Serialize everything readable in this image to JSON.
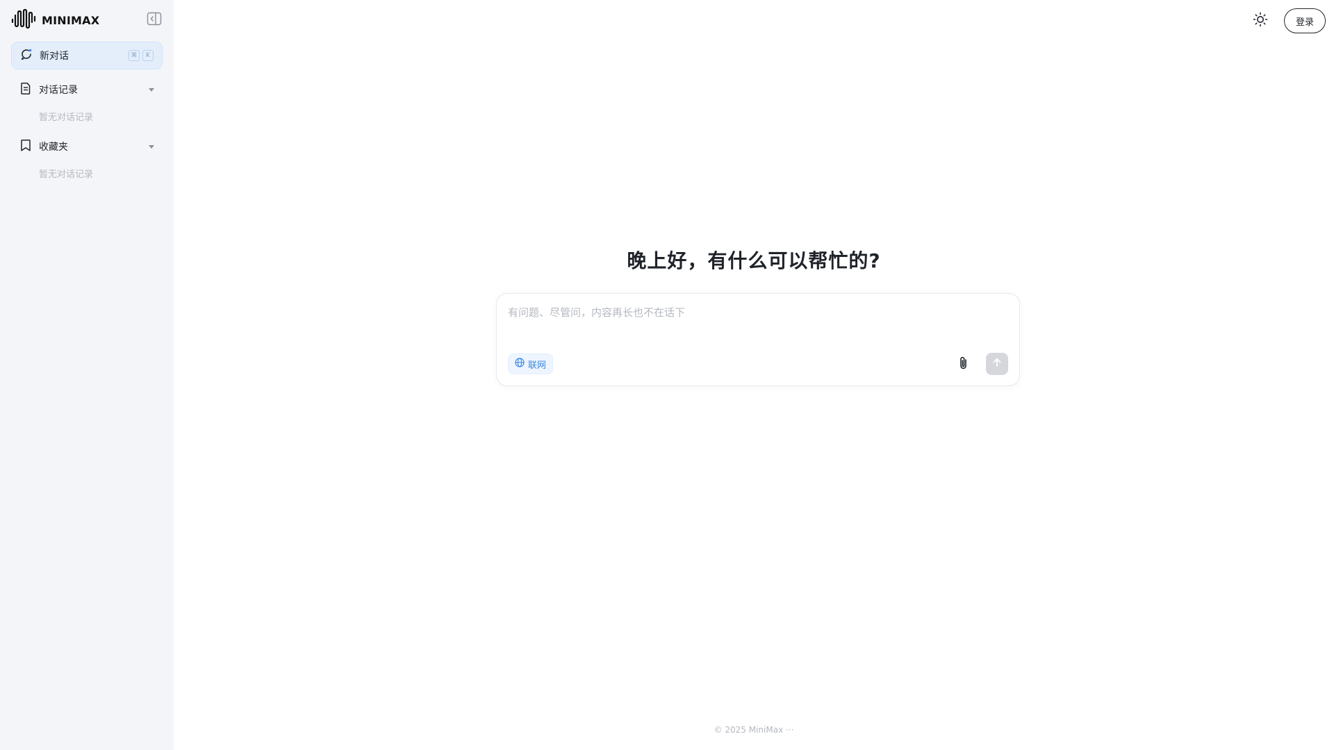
{
  "brand": {
    "name": "MINIMAX"
  },
  "sidebar": {
    "new_chat": {
      "label": "新对话",
      "shortcut": [
        "⌘",
        "K"
      ]
    },
    "history": {
      "title": "对话记录",
      "empty": "暂无对话记录"
    },
    "favorites": {
      "title": "收藏夹",
      "empty": "暂无对话记录"
    }
  },
  "header": {
    "login_label": "登录"
  },
  "main": {
    "greeting": "晚上好，有什么可以帮忙的?",
    "input": {
      "placeholder": "有问题、尽管问，内容再长也不在话下",
      "value": ""
    },
    "web_search_label": "联网"
  },
  "footer": {
    "text": "© 2025 MiniMax ···"
  },
  "colors": {
    "accent": "#3a87e0",
    "sidebar_bg": "#f3f5f8",
    "new_chat_bg": "#e4eefb"
  }
}
